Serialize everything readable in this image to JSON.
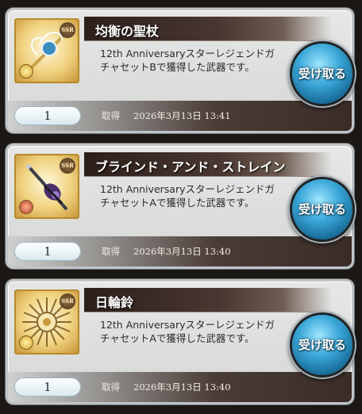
{
  "items": [
    {
      "name": "均衡の聖杖",
      "rarity": "SSR",
      "description": "12th AnniversaryスターレジェンドガチャセットBで獲得した武器です。",
      "quantity": "1",
      "acquired_label": "取得",
      "acquired_date": "2026年3月13日 13:41",
      "receive_label": "受け取る",
      "icon": "staff-icon",
      "element_color": "#e9c64a"
    },
    {
      "name": "ブラインド・アンド・ストレイン",
      "rarity": "SSR",
      "description": "12th AnniversaryスターレジェンドガチャセットAで獲得した武器です。",
      "quantity": "1",
      "acquired_label": "取得",
      "acquired_date": "2026年3月13日 13:40",
      "receive_label": "受け取る",
      "icon": "scepter-icon",
      "element_color": "#c0392b"
    },
    {
      "name": "日輪鈴",
      "rarity": "SSR",
      "description": "12th AnniversaryスターレジェンドガチャセットAで獲得した武器です。",
      "quantity": "1",
      "acquired_label": "取得",
      "acquired_date": "2026年3月13日 13:40",
      "receive_label": "受け取る",
      "icon": "sun-bell-icon",
      "element_color": "#e9c64a"
    }
  ]
}
